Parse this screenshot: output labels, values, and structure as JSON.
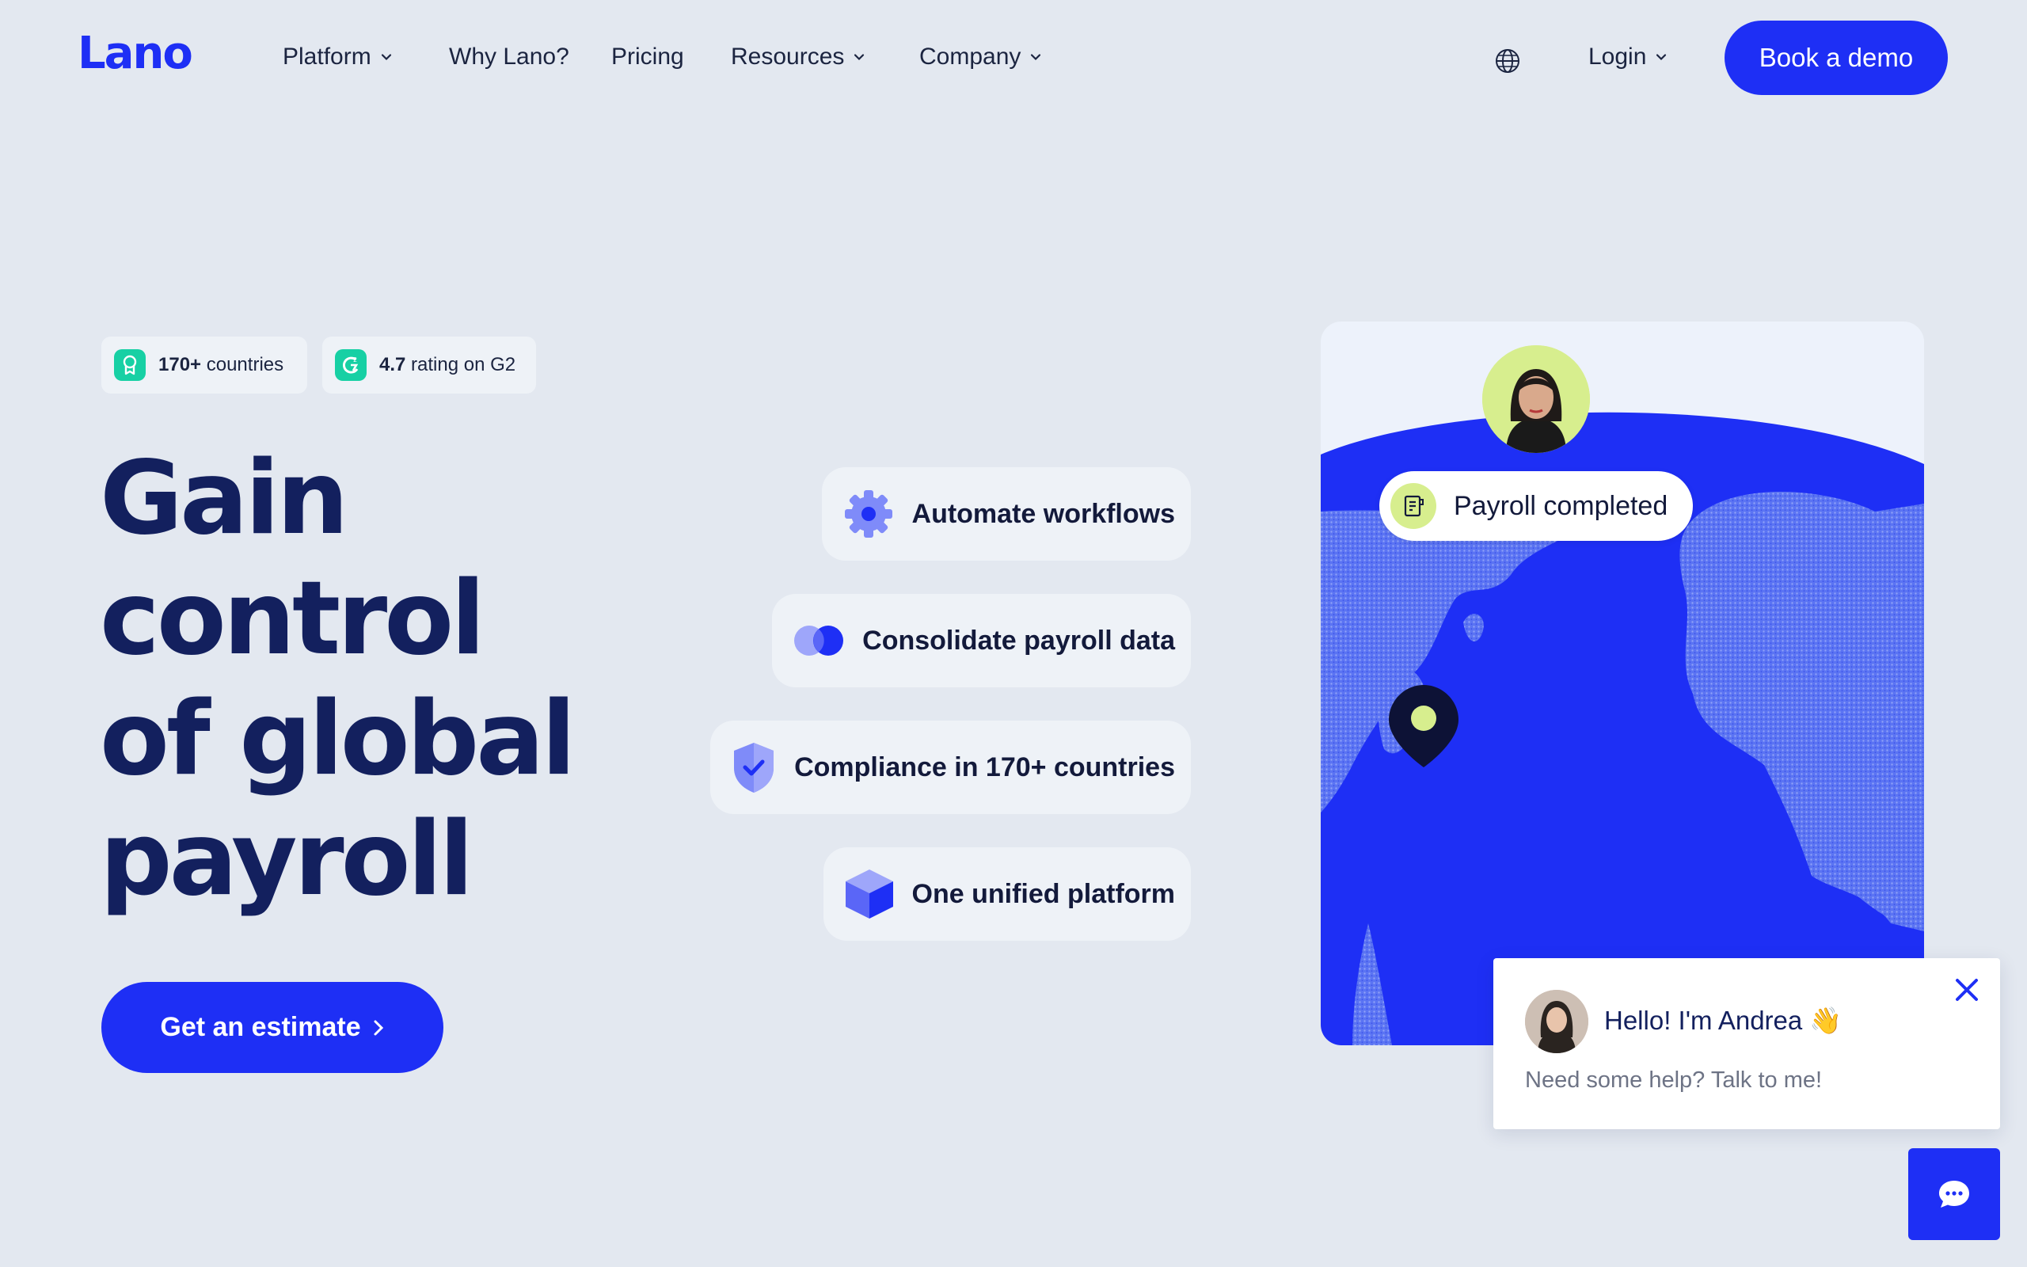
{
  "brand": {
    "logo_text": "Lano",
    "accent": "#1e2ff5",
    "heading_color": "#13205e",
    "background": "#e3e8f0"
  },
  "nav": {
    "items": [
      {
        "label": "Platform",
        "has_dropdown": true
      },
      {
        "label": "Why Lano?",
        "has_dropdown": false
      },
      {
        "label": "Pricing",
        "has_dropdown": false
      },
      {
        "label": "Resources",
        "has_dropdown": true
      },
      {
        "label": "Company",
        "has_dropdown": true
      }
    ],
    "language_icon": "globe-icon",
    "login_label": "Login",
    "demo_label": "Book a demo"
  },
  "badges": [
    {
      "strong": "170+",
      "text": "countries",
      "icon": "award-icon"
    },
    {
      "strong": "4.7",
      "text": "rating on G2",
      "icon": "g2-icon"
    }
  ],
  "hero": {
    "title_lines": [
      "Gain",
      "control",
      "of global",
      "payroll"
    ],
    "cta_label": "Get an estimate"
  },
  "features": [
    {
      "label": "Automate workflows",
      "icon": "gear-icon"
    },
    {
      "label": "Consolidate payroll data",
      "icon": "circles-icon"
    },
    {
      "label": "Compliance in 170+ countries",
      "icon": "shield-check-icon"
    },
    {
      "label": "One unified platform",
      "icon": "cube-icon"
    }
  ],
  "map_card": {
    "status_label": "Payroll completed",
    "status_icon": "receipt-icon",
    "pin_icon": "map-pin-icon"
  },
  "chat": {
    "greeting": "Hello! I'm Andrea 👋",
    "subtext": "Need some help? Talk to me!",
    "close_icon": "close-icon",
    "fab_icon": "chat-bubble-icon"
  }
}
